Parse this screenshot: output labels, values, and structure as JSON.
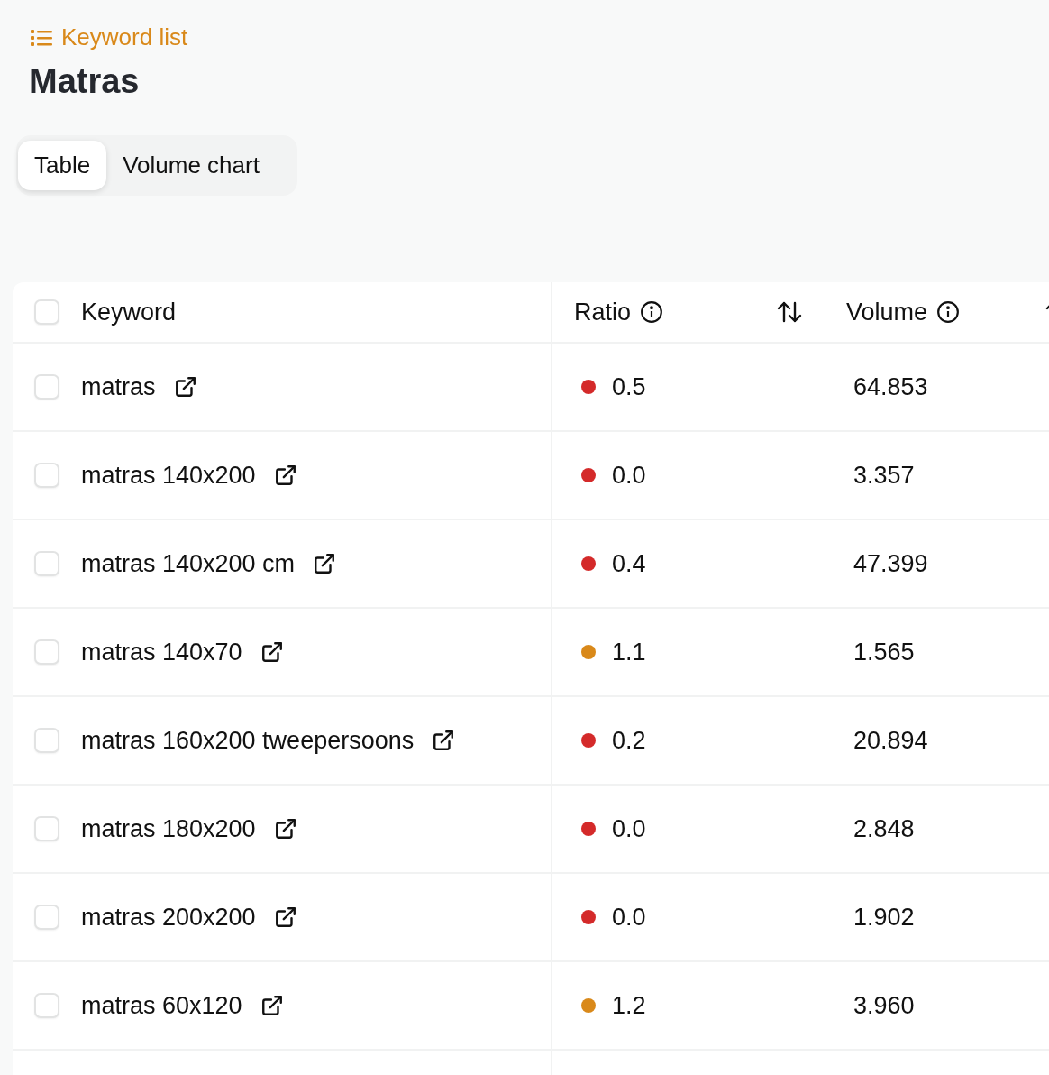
{
  "breadcrumb": {
    "label": "Keyword list"
  },
  "title": "Matras",
  "tabs": [
    {
      "label": "Table",
      "selected": true
    },
    {
      "label": "Volume chart",
      "selected": false
    }
  ],
  "table": {
    "columns": [
      {
        "label": "Keyword",
        "kind": "select"
      },
      {
        "label": "Ratio",
        "kind": "info-sort"
      },
      {
        "label": "Volume",
        "kind": "info-sort"
      }
    ],
    "header_checked": false,
    "rows": [
      {
        "keyword": "matras",
        "checked": false,
        "ratio": "0.5",
        "color": "#d42a2a",
        "volume": "64.853"
      },
      {
        "keyword": "matras 140x200",
        "checked": false,
        "ratio": "0.0",
        "color": "#d42a2a",
        "volume": "3.357"
      },
      {
        "keyword": "matras 140x200 cm",
        "checked": false,
        "ratio": "0.4",
        "color": "#d42a2a",
        "volume": "47.399"
      },
      {
        "keyword": "matras 140x70",
        "checked": false,
        "ratio": "1.1",
        "color": "#d9891a",
        "volume": "1.565"
      },
      {
        "keyword": "matras 160x200 tweepersoons",
        "checked": false,
        "ratio": "0.2",
        "color": "#d42a2a",
        "volume": "20.894"
      },
      {
        "keyword": "matras 180x200",
        "checked": false,
        "ratio": "0.0",
        "color": "#d42a2a",
        "volume": "2.848"
      },
      {
        "keyword": "matras 200x200",
        "checked": false,
        "ratio": "0.0",
        "color": "#d42a2a",
        "volume": "1.902"
      },
      {
        "keyword": "matras 60x120",
        "checked": false,
        "ratio": "1.2",
        "color": "#d9891a",
        "volume": "3.960"
      }
    ]
  }
}
